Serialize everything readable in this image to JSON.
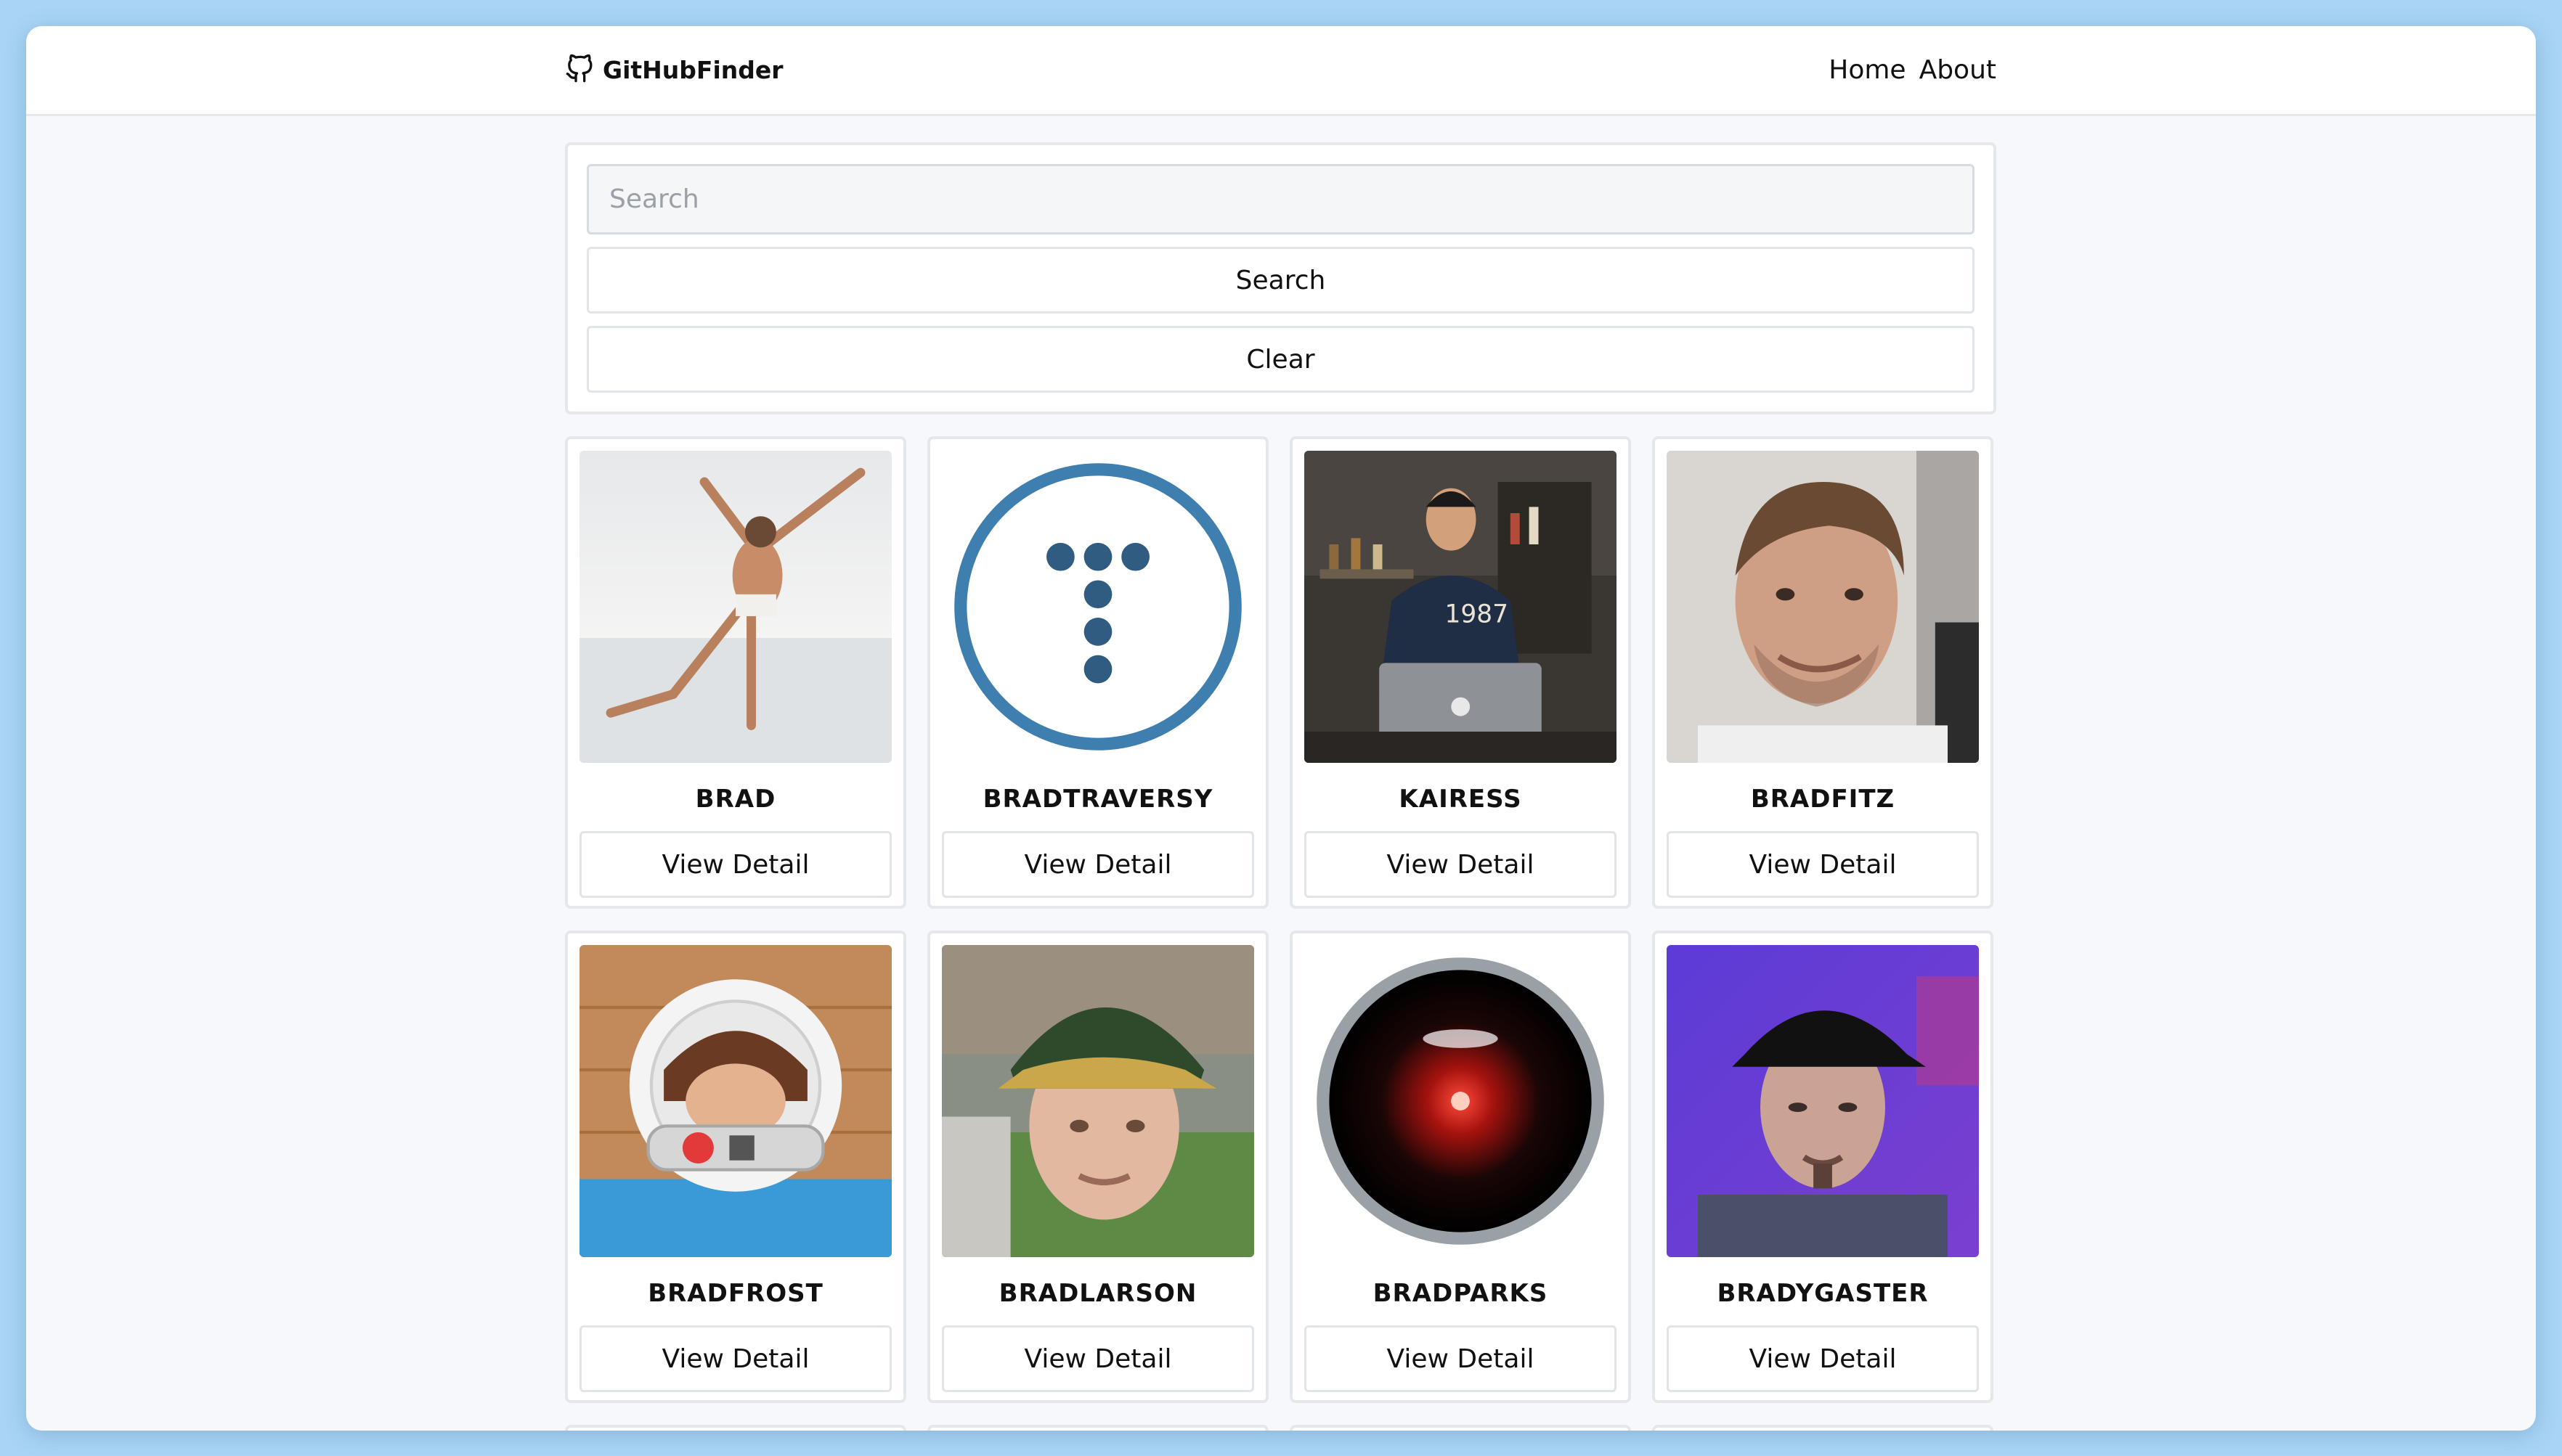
{
  "navbar": {
    "brand": "GitHubFinder",
    "links": [
      "Home",
      "About"
    ]
  },
  "search": {
    "placeholder": "Search",
    "value": "",
    "search_button": "Search",
    "clear_button": "Clear"
  },
  "users": [
    {
      "login": "BRAD",
      "button": "View Detail"
    },
    {
      "login": "BRADTRAVERSY",
      "button": "View Detail"
    },
    {
      "login": "KAIRESS",
      "button": "View Detail"
    },
    {
      "login": "BRADFITZ",
      "button": "View Detail"
    },
    {
      "login": "BRADFROST",
      "button": "View Detail"
    },
    {
      "login": "BRADLARSON",
      "button": "View Detail"
    },
    {
      "login": "BRADPARKS",
      "button": "View Detail"
    },
    {
      "login": "BRADYGASTER",
      "button": "View Detail"
    }
  ],
  "colors": {
    "page_background": "#a9d4f5",
    "content_background": "#f6f8fb",
    "card_border": "#e4e7eb",
    "traversy_blue": "#3f7fb0"
  },
  "icons": [
    "github-icon"
  ]
}
